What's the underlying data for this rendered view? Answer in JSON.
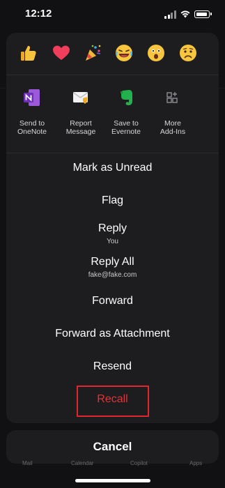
{
  "status_bar": {
    "time": "12:12"
  },
  "reactions": [
    {
      "name": "thumbs-up",
      "glyph": "👍"
    },
    {
      "name": "heart",
      "glyph": "❤️"
    },
    {
      "name": "party-popper",
      "glyph": "🎉"
    },
    {
      "name": "laughing-face",
      "glyph": "😂"
    },
    {
      "name": "surprised-face",
      "glyph": "😮"
    },
    {
      "name": "sad-face",
      "glyph": "😢"
    }
  ],
  "addins": [
    {
      "line1": "Send to",
      "line2": "OneNote",
      "icon": "onenote-icon"
    },
    {
      "line1": "Report",
      "line2": "Message",
      "icon": "report-message-icon"
    },
    {
      "line1": "Save to",
      "line2": "Evernote",
      "icon": "evernote-icon"
    },
    {
      "line1": "More",
      "line2": "Add-Ins",
      "icon": "more-addins-icon"
    }
  ],
  "actions": {
    "mark_unread": "Mark as Unread",
    "flag": "Flag",
    "reply": "Reply",
    "reply_sub": "You",
    "reply_all": "Reply All",
    "reply_all_sub": "fake@fake.com",
    "forward": "Forward",
    "forward_attachment": "Forward as Attachment",
    "resend": "Resend",
    "recall": "Recall"
  },
  "cancel": "Cancel",
  "tabbar": {
    "mail": "Mail",
    "calendar": "Calendar",
    "copilot": "Copilot",
    "apps": "Apps"
  },
  "colors": {
    "sheet": "#1d1d1f",
    "recall": "#e0333a",
    "highlight": "#e0262f",
    "onenote": "#7b3fc4",
    "evernote": "#00a82d"
  }
}
